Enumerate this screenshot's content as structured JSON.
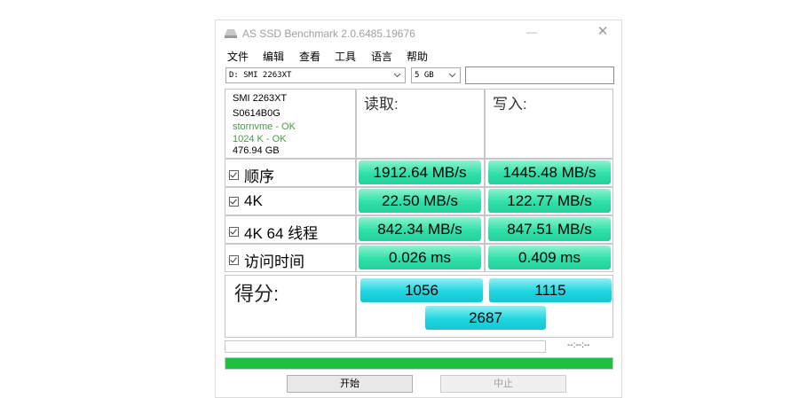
{
  "window": {
    "title": "AS SSD Benchmark 2.0.6485.19676",
    "minimize_glyph": "—",
    "close_glyph": "✕"
  },
  "menu": [
    "文件",
    "编辑",
    "查看",
    "工具",
    "语言",
    "帮助"
  ],
  "controls": {
    "drive_select": "D: SMI 2263XT",
    "size_select": "5 GB",
    "text_field": ""
  },
  "drive_info": {
    "model": "SMI 2263XT",
    "firmware": "S0614B0G",
    "driver_status": "stornvme - OK",
    "alignment_status": "1024 K - OK",
    "capacity": "476.94 GB"
  },
  "columns": {
    "read": "读取:",
    "write": "写入:"
  },
  "rows": [
    {
      "label": "顺序",
      "read": "1912.64 MB/s",
      "write": "1445.48 MB/s"
    },
    {
      "label": "4K",
      "read": "22.50 MB/s",
      "write": "122.77 MB/s"
    },
    {
      "label": "4K 64 线程",
      "read": "842.34 MB/s",
      "write": "847.51 MB/s"
    },
    {
      "label": "访问时间",
      "read": "0.026 ms",
      "write": "0.409 ms"
    }
  ],
  "score": {
    "label": "得分:",
    "read": "1056",
    "write": "1115",
    "total": "2687"
  },
  "status": {
    "time": "--:--:--",
    "small_progress": 0,
    "main_progress": 1.0
  },
  "buttons": {
    "start": "开始",
    "stop": "中止"
  },
  "colors": {
    "result_green": "#2fe0a8",
    "score_cyan": "#1fd6e0",
    "progress_green": "#20c040",
    "status_ok_green": "#4a9a4a"
  },
  "icons": {
    "app": "drive-icon",
    "checkbox": "checkbox-checked-icon",
    "dropdown": "chevron-down-icon"
  }
}
